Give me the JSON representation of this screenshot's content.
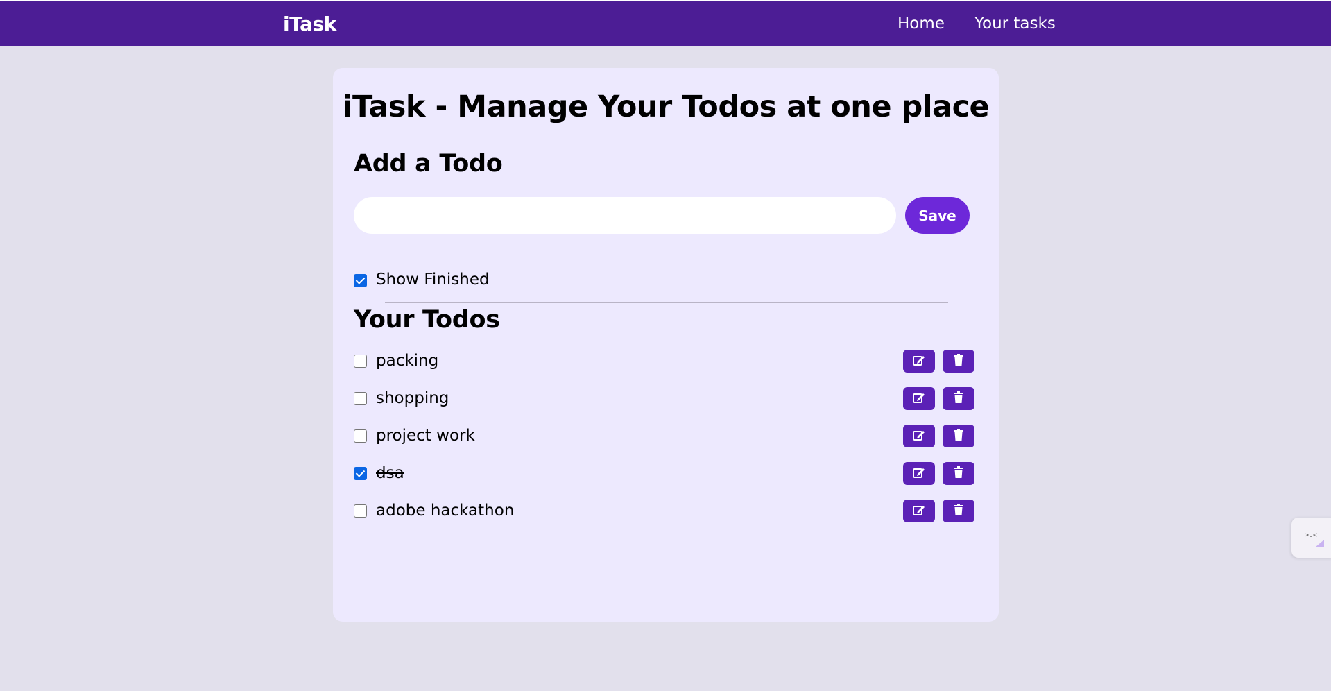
{
  "nav": {
    "brand": "iTask",
    "links": [
      "Home",
      "Your tasks"
    ]
  },
  "main": {
    "title": "iTask - Manage Your Todos at one place",
    "add_heading": "Add a Todo",
    "input": {
      "value": "",
      "placeholder": ""
    },
    "save_label": "Save",
    "show_finished": {
      "label": "Show Finished",
      "checked": true
    },
    "todos_heading": "Your Todos",
    "todos": [
      {
        "text": "packing",
        "done": false
      },
      {
        "text": "shopping",
        "done": false
      },
      {
        "text": "project work",
        "done": false
      },
      {
        "text": "dsa",
        "done": true
      },
      {
        "text": "adobe hackathon",
        "done": false
      }
    ]
  },
  "colors": {
    "nav_bg": "#4c1d95",
    "card_bg": "#ede9fe",
    "accent": "#6d28d9",
    "icon_button": "#5b21b6",
    "page_bg": "#e2e0ec"
  },
  "icons": {
    "edit": "edit-icon",
    "delete": "trash-icon",
    "widget": "extension-widget-icon"
  }
}
